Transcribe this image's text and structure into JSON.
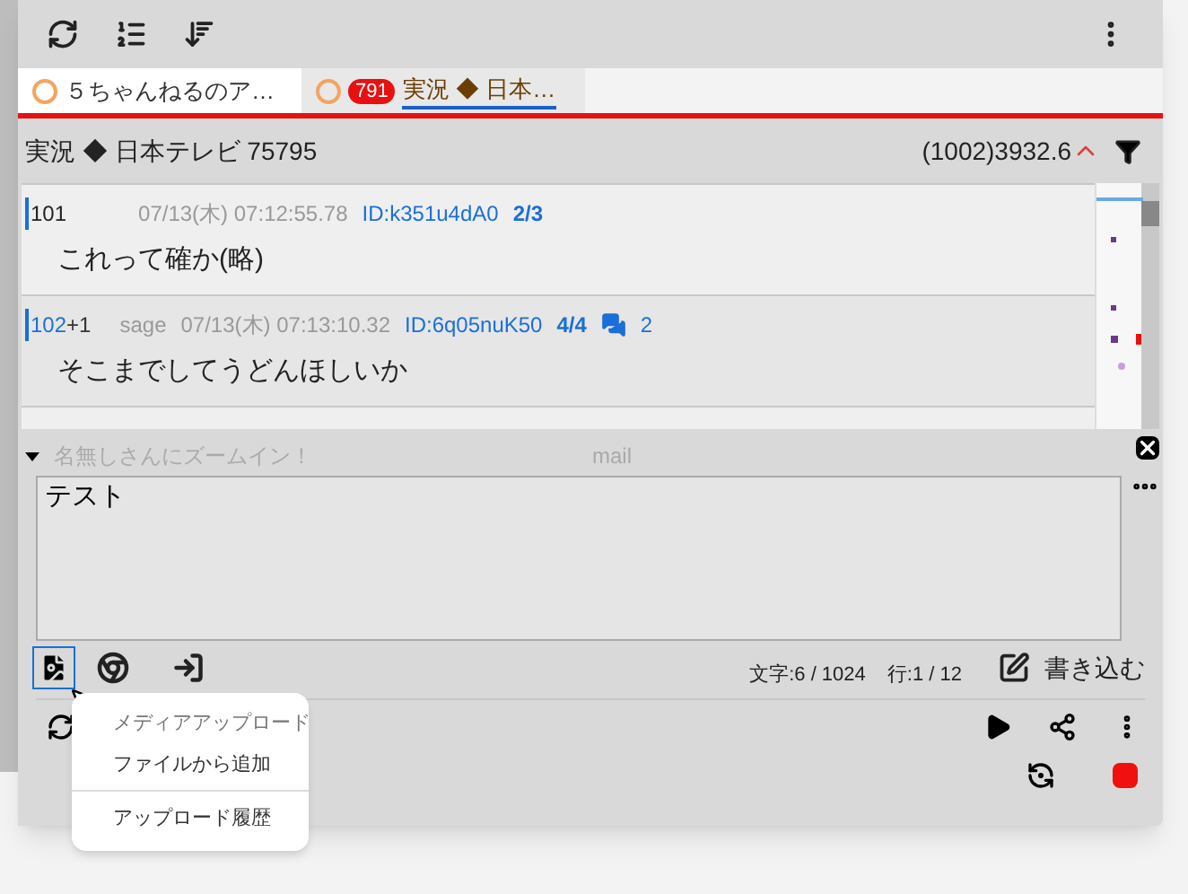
{
  "tabs": [
    {
      "title": "５ちゃんねるのア…",
      "selected": false
    },
    {
      "title": "実況 ◆ 日本…",
      "badge": "791",
      "selected": true
    }
  ],
  "thread": {
    "title": "実況 ◆ 日本テレビ 75795",
    "stats": "(1002)3932.6"
  },
  "posts": [
    {
      "number": "101",
      "linked": false,
      "date": "07/13(木) 07:12:55.78",
      "id": "ID:k351u4dA0",
      "count": "2/3",
      "body": "これって確か(略)"
    },
    {
      "number": "102",
      "linked": true,
      "plus": "+1",
      "mail": "sage",
      "date": "07/13(木) 07:13:10.32",
      "id": "ID:6q05nuK50",
      "count": "4/4",
      "replies": "2",
      "body": "そこまでしてうどんほしいか"
    }
  ],
  "form": {
    "name_placeholder": "名無しさんにズームイン！",
    "mail_placeholder": "mail",
    "message": "テスト",
    "char_count": "文字:6 / 1024",
    "line_count": "行:1 / 12",
    "submit": "書き込む"
  },
  "menu": {
    "header": "メディアアップロード",
    "items": [
      {
        "label": "ファイルから追加"
      },
      {
        "label": "アップロード履歴"
      }
    ]
  }
}
